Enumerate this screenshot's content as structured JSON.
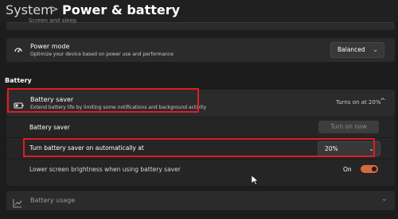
{
  "header": {
    "breadcrumb_root": "System",
    "separator": ">",
    "title": "Power & battery"
  },
  "cut_row": {
    "label": "Screen and sleep"
  },
  "power_mode": {
    "icon": "power-mode-icon",
    "title": "Power mode",
    "description": "Optimize your device based on power use and performance",
    "selected": "Balanced"
  },
  "battery_section": {
    "label": "Battery"
  },
  "battery_saver": {
    "icon": "battery-saver-icon",
    "title": "Battery saver",
    "description": "Extend battery life by limiting some notifications and background activity",
    "status": "Turns on at 20%",
    "rows": {
      "saver_label": "Battery saver",
      "turn_on_button": "Turn on now",
      "auto_label": "Turn battery saver on automatically at",
      "auto_value": "20%",
      "brightness_label": "Lower screen brightness when using battery saver",
      "brightness_state": "On"
    }
  },
  "battery_usage": {
    "icon": "chart-icon",
    "title": "Battery usage"
  },
  "colors": {
    "accent": "#d66a3c",
    "highlight": "#e21b22"
  }
}
